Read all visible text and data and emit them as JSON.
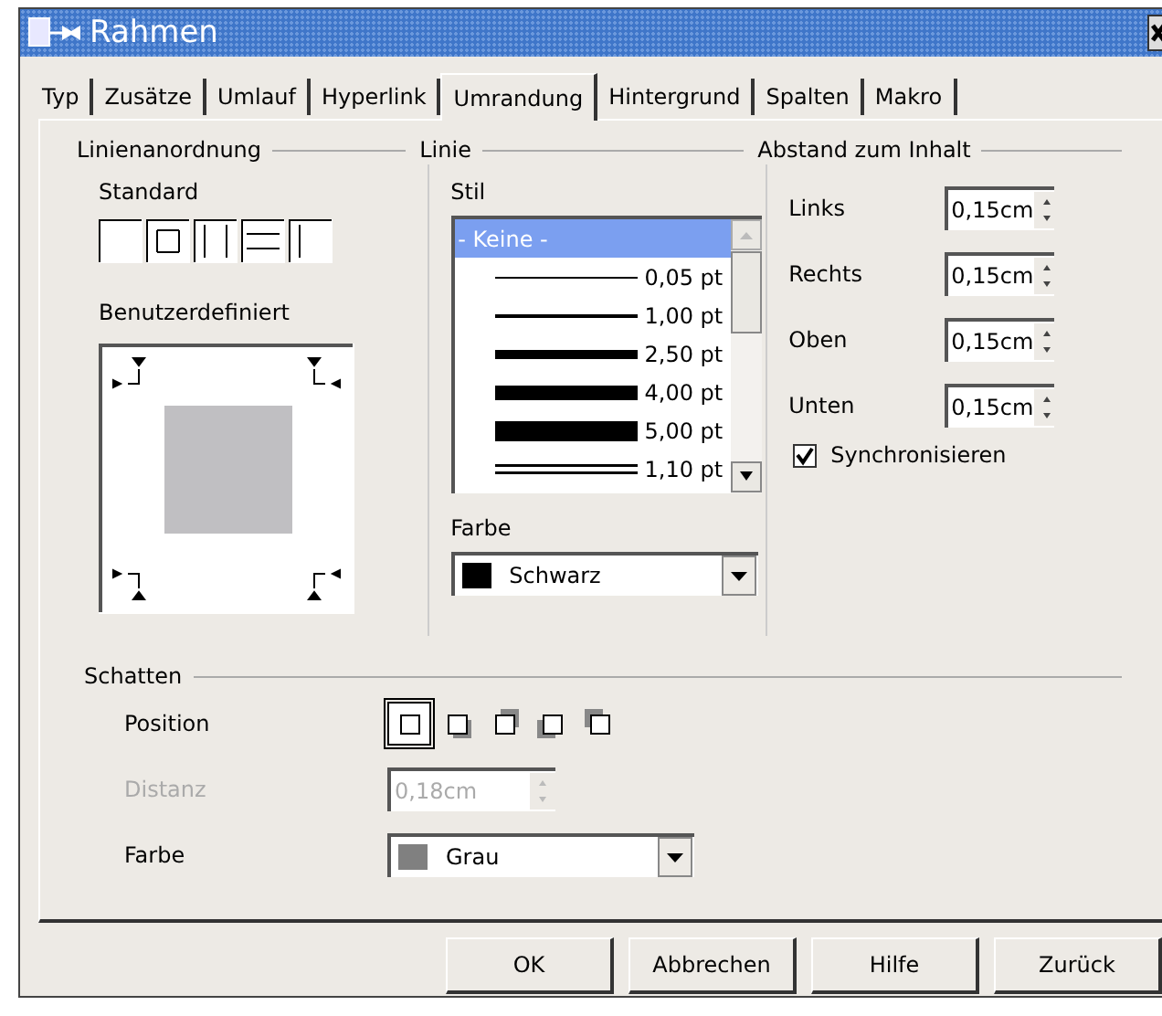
{
  "window": {
    "title": "Rahmen"
  },
  "tabs": [
    {
      "label": "Typ",
      "selected": false
    },
    {
      "label": "Zusätze",
      "selected": false
    },
    {
      "label": "Umlauf",
      "selected": false
    },
    {
      "label": "Hyperlink",
      "selected": false
    },
    {
      "label": "Umrandung",
      "selected": true
    },
    {
      "label": "Hintergrund",
      "selected": false
    },
    {
      "label": "Spalten",
      "selected": false
    },
    {
      "label": "Makro",
      "selected": false
    }
  ],
  "line_arrangement": {
    "title": "Linienanordnung",
    "default_label": "Standard",
    "presets": [
      {
        "kind": "none"
      },
      {
        "kind": "box"
      },
      {
        "kind": "sides"
      },
      {
        "kind": "topbottom"
      },
      {
        "kind": "left"
      }
    ],
    "custom_label": "Benutzerdefiniert"
  },
  "line": {
    "title": "Linie",
    "style_label": "Stil",
    "styles": [
      {
        "kind": "none",
        "label": "- Keine -",
        "selected": true
      },
      {
        "kind": "hairline",
        "label": "0,05 pt",
        "selected": false
      },
      {
        "kind": "thin",
        "label": "1,00 pt",
        "selected": false
      },
      {
        "kind": "medium",
        "label": "2,50 pt",
        "selected": false
      },
      {
        "kind": "thick",
        "label": "4,00 pt",
        "selected": false
      },
      {
        "kind": "heavy",
        "label": "5,00 pt",
        "selected": false
      },
      {
        "kind": "double",
        "label": "1,10 pt",
        "selected": false
      }
    ],
    "color_label": "Farbe",
    "color": {
      "name": "Schwarz",
      "color": "#000000"
    }
  },
  "spacing": {
    "title": "Abstand zum Inhalt",
    "fields": [
      {
        "label": "Links",
        "value": "0,15cm"
      },
      {
        "label": "Rechts",
        "value": "0,15cm"
      },
      {
        "label": "Oben",
        "value": "0,15cm"
      },
      {
        "label": "Unten",
        "value": "0,15cm"
      }
    ],
    "sync": {
      "label": "Synchronisieren",
      "checked": true
    }
  },
  "shadow": {
    "title": "Schatten",
    "position_label": "Position",
    "positions": [
      {
        "kind": "none",
        "selected": true
      },
      {
        "kind": "bottom-right",
        "selected": false
      },
      {
        "kind": "top-right",
        "selected": false
      },
      {
        "kind": "bottom-left",
        "selected": false
      },
      {
        "kind": "top-left",
        "selected": false
      }
    ],
    "distance": {
      "label": "Distanz",
      "value": "0,18cm",
      "disabled": true
    },
    "color_label": "Farbe",
    "color": {
      "name": "Grau",
      "color": "#808080"
    }
  },
  "buttons": [
    "OK",
    "Abbrechen",
    "Hilfe",
    "Zurück"
  ]
}
